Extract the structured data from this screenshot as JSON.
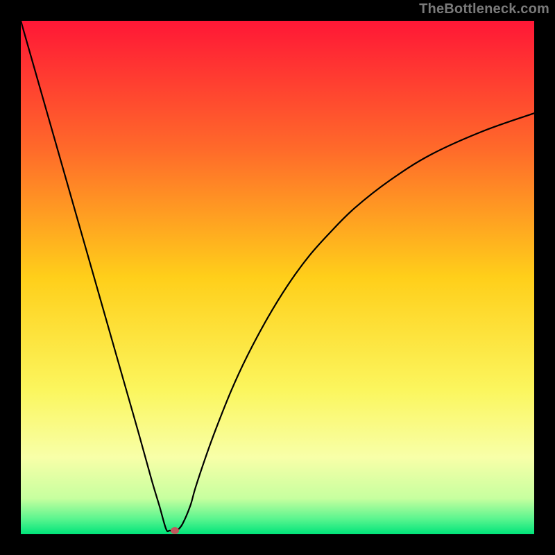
{
  "watermark": "TheBottleneck.com",
  "chart_data": {
    "type": "line",
    "title": "",
    "xlabel": "",
    "ylabel": "",
    "xlim": [
      0,
      100
    ],
    "ylim": [
      0,
      100
    ],
    "grid": false,
    "series": [
      {
        "name": "curve",
        "x": [
          0,
          2,
          5,
          8,
          11,
          14,
          17,
          20,
          23,
          25.5,
          27,
          28.3,
          29,
          30,
          30.5,
          31.5,
          33,
          34,
          36,
          38,
          41,
          44,
          48,
          52,
          56,
          60,
          65,
          72,
          80,
          90,
          100
        ],
        "values": [
          100,
          93,
          82.5,
          72,
          61.5,
          51,
          40.5,
          30,
          19.5,
          10.5,
          5.5,
          1,
          0.7,
          0.7,
          0.8,
          2,
          5.5,
          9,
          15,
          20.5,
          28,
          34.5,
          42,
          48.5,
          54,
          58.5,
          63.5,
          69,
          74,
          78.5,
          82
        ]
      }
    ],
    "marker": {
      "x": 30,
      "y": 0.7,
      "color": "#c1575c"
    },
    "background_gradient": [
      {
        "offset": 0.0,
        "color": "#ff1736"
      },
      {
        "offset": 0.25,
        "color": "#ff6a2a"
      },
      {
        "offset": 0.5,
        "color": "#ffcf1a"
      },
      {
        "offset": 0.72,
        "color": "#fbf65e"
      },
      {
        "offset": 0.85,
        "color": "#f8ffa8"
      },
      {
        "offset": 0.93,
        "color": "#c7ff9f"
      },
      {
        "offset": 0.97,
        "color": "#5bf58f"
      },
      {
        "offset": 1.0,
        "color": "#00e47a"
      }
    ]
  }
}
